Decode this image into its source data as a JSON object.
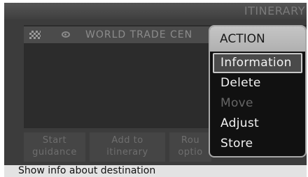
{
  "app_title": "ITINERARY",
  "destination": {
    "name": "WORLD TRADE CEN",
    "flag_icon": "checkered-flag-icon",
    "visibility_icon": "eye-icon"
  },
  "buttons": {
    "start_guidance": [
      "Start",
      "guidance"
    ],
    "add_to_itinerary": [
      "Add to",
      "itinerary"
    ],
    "route_options": [
      "Rou",
      "optio"
    ]
  },
  "menu": {
    "title": "ACTION",
    "items": [
      {
        "label": "Information",
        "state": "selected"
      },
      {
        "label": "Delete",
        "state": "enabled"
      },
      {
        "label": "Move",
        "state": "disabled"
      },
      {
        "label": "Adjust",
        "state": "enabled"
      },
      {
        "label": "Store",
        "state": "enabled"
      }
    ]
  },
  "status": "Show info about destination"
}
